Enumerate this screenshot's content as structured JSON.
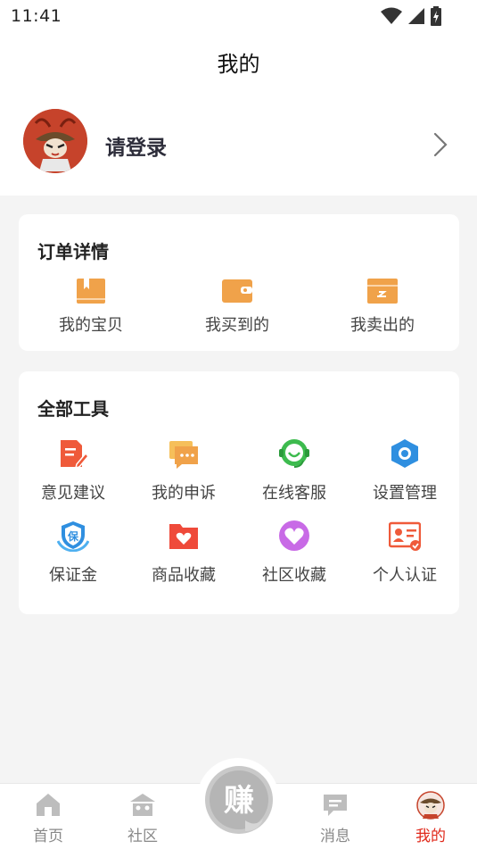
{
  "status_bar": {
    "time": "11:41"
  },
  "header": {
    "title": "我的"
  },
  "profile": {
    "login_text": "请登录"
  },
  "orders": {
    "title": "订单详情",
    "items": [
      {
        "label": "我的宝贝",
        "icon": "bookmark-box-icon"
      },
      {
        "label": "我买到的",
        "icon": "wallet-icon"
      },
      {
        "label": "我卖出的",
        "icon": "box-icon"
      }
    ]
  },
  "tools": {
    "title": "全部工具",
    "items": [
      {
        "label": "意见建议",
        "icon": "feedback-edit-icon"
      },
      {
        "label": "我的申诉",
        "icon": "chat-bubble-icon"
      },
      {
        "label": "在线客服",
        "icon": "headset-icon"
      },
      {
        "label": "设置管理",
        "icon": "gear-icon"
      },
      {
        "label": "保证金",
        "icon": "deposit-shield-icon"
      },
      {
        "label": "商品收藏",
        "icon": "heart-folder-icon"
      },
      {
        "label": "社区收藏",
        "icon": "heart-circle-icon"
      },
      {
        "label": "个人认证",
        "icon": "id-card-icon"
      }
    ]
  },
  "tabbar": {
    "items": [
      {
        "label": "首页",
        "icon": "home-icon",
        "active": false
      },
      {
        "label": "社区",
        "icon": "community-icon",
        "active": false
      },
      {
        "label": "消息",
        "icon": "message-icon",
        "active": false
      },
      {
        "label": "我的",
        "icon": "avatar-icon",
        "active": true
      }
    ],
    "center_button_text": "赚"
  },
  "colors": {
    "accent_orange": "#f0a24a",
    "tool_red": "#ef5a3a",
    "tool_green": "#3dbb4e",
    "tool_blue": "#2f8fe0",
    "tool_purple": "#c86ae6",
    "active_tab": "#e0291b"
  }
}
